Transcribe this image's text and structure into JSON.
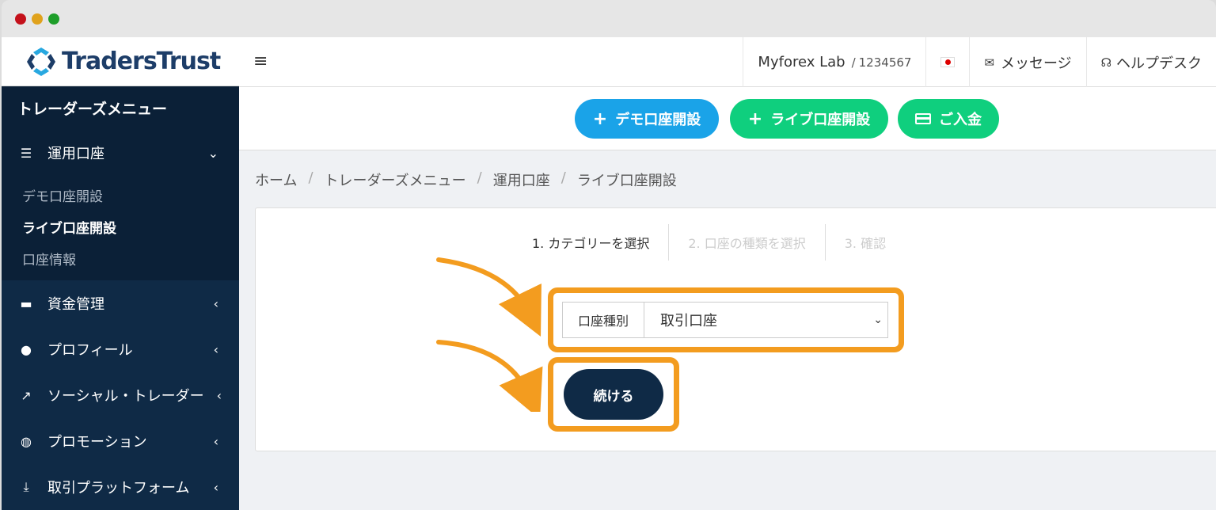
{
  "brand": {
    "name": "TradersTrust"
  },
  "topbar": {
    "menu_icon": "hamburger-icon",
    "account_name": "Myforex Lab",
    "account_sep": "/",
    "account_id": "1234567",
    "messages": "メッセージ",
    "helpdesk": "ヘルプデスク"
  },
  "sidebar": {
    "header": "トレーダーズメニュー",
    "items": [
      {
        "label": "運用口座",
        "icon": "list-icon",
        "arrow": "⌄"
      },
      {
        "label": "資金管理",
        "icon": "wallet-icon",
        "arrow": "‹"
      },
      {
        "label": "プロフィール",
        "icon": "user-icon",
        "arrow": "‹"
      },
      {
        "label": "ソーシャル・トレーダー",
        "icon": "chart-icon",
        "arrow": "‹"
      },
      {
        "label": "プロモーション",
        "icon": "globe-icon",
        "arrow": "‹"
      },
      {
        "label": "取引プラットフォーム",
        "icon": "download-icon",
        "arrow": "‹"
      }
    ],
    "submenu": [
      "デモ口座開設",
      "ライブ口座開設",
      "口座情報"
    ]
  },
  "actions": {
    "demo": "デモ口座開設",
    "live": "ライブ口座開設",
    "deposit": "ご入金"
  },
  "breadcrumb": [
    "ホーム",
    "トレーダーズメニュー",
    "運用口座",
    "ライブ口座開設"
  ],
  "steps": [
    "1. カテゴリーを選択",
    "2. 口座の種類を選択",
    "3. 確認"
  ],
  "form": {
    "label": "口座種別",
    "value": "取引口座",
    "continue": "続ける"
  },
  "colors": {
    "accent": "#f39c1f",
    "navy": "#0f2a46",
    "blue": "#1aa3e8",
    "green": "#0fcf7e"
  }
}
